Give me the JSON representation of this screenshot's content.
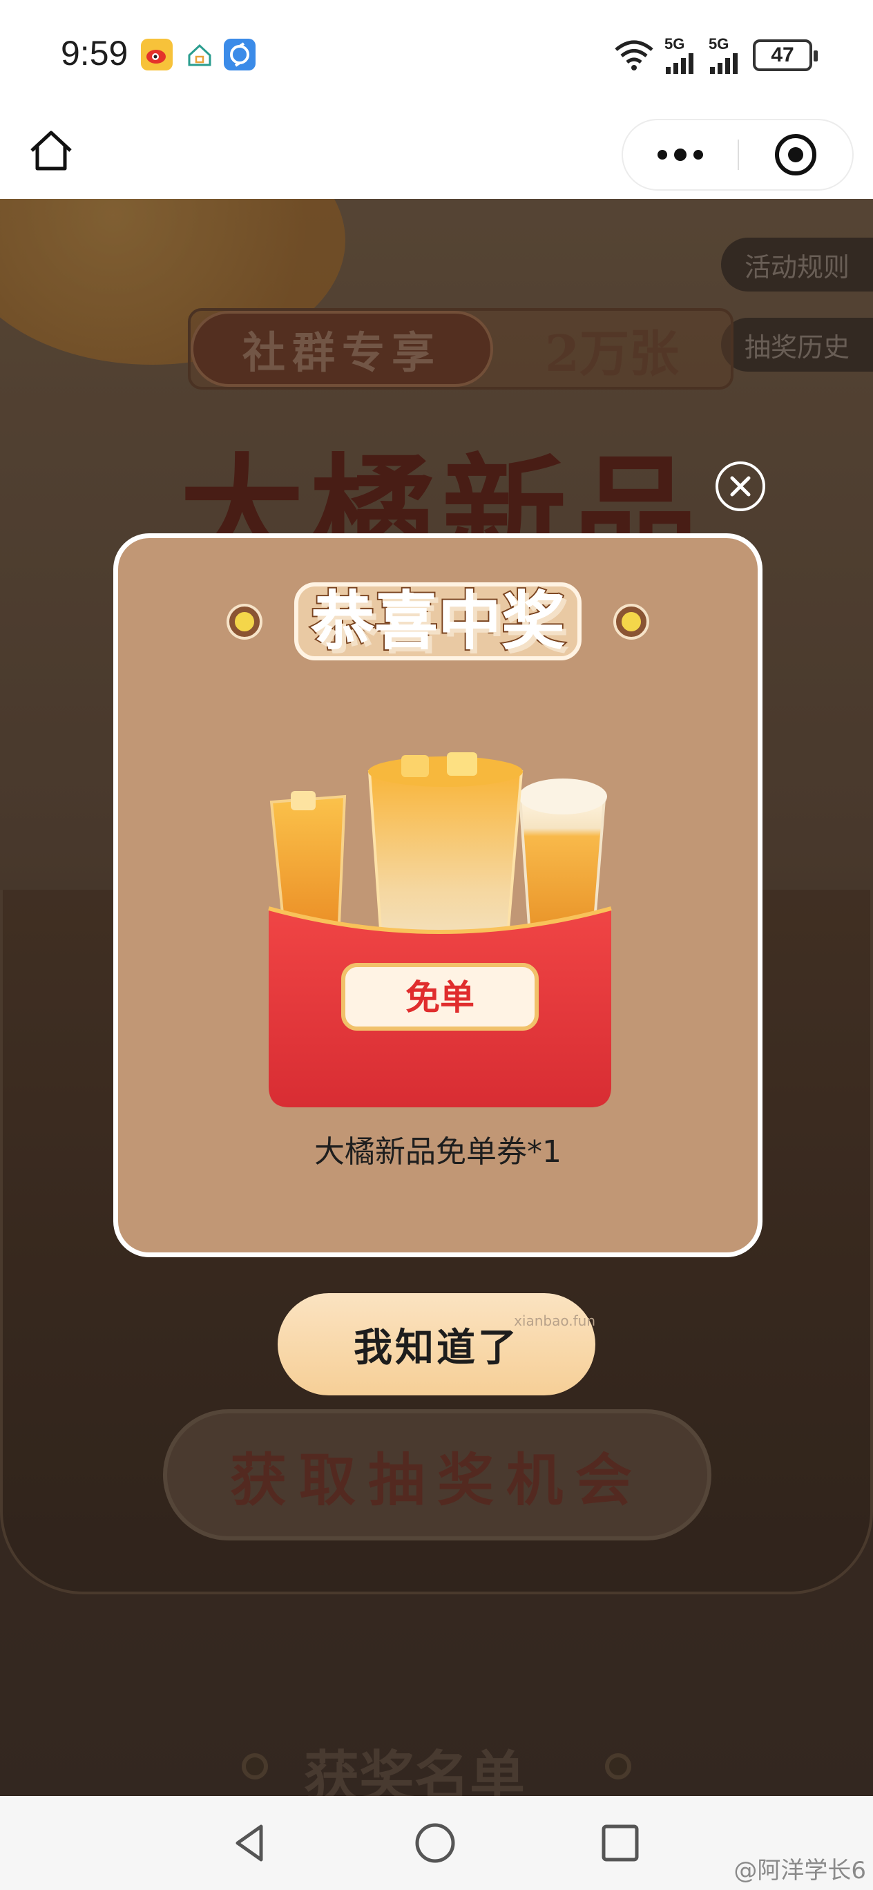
{
  "status_bar": {
    "time": "9:59",
    "signal_1": "5G",
    "signal_2": "5G",
    "battery": "47"
  },
  "page": {
    "rules_button": "活动规则",
    "history_button": "抽奖历史",
    "banner_tag": "社群专享",
    "banner_count": "2万张",
    "main_title": "大橘新品",
    "draw_button": "获取抽奖机会",
    "winners_title": "获奖名单"
  },
  "modal": {
    "title": "恭喜中奖",
    "prize_badge": "免单",
    "prize_desc": "大橘新品免单券*1",
    "ok_button": "我知道了",
    "watermark": "xianbao.fun"
  },
  "footer": {
    "watermark": "@阿洋学长6"
  },
  "colors": {
    "modal_bg": "#c19775",
    "ok_button": "#f6cf97",
    "prize_red": "#e63a3a"
  }
}
